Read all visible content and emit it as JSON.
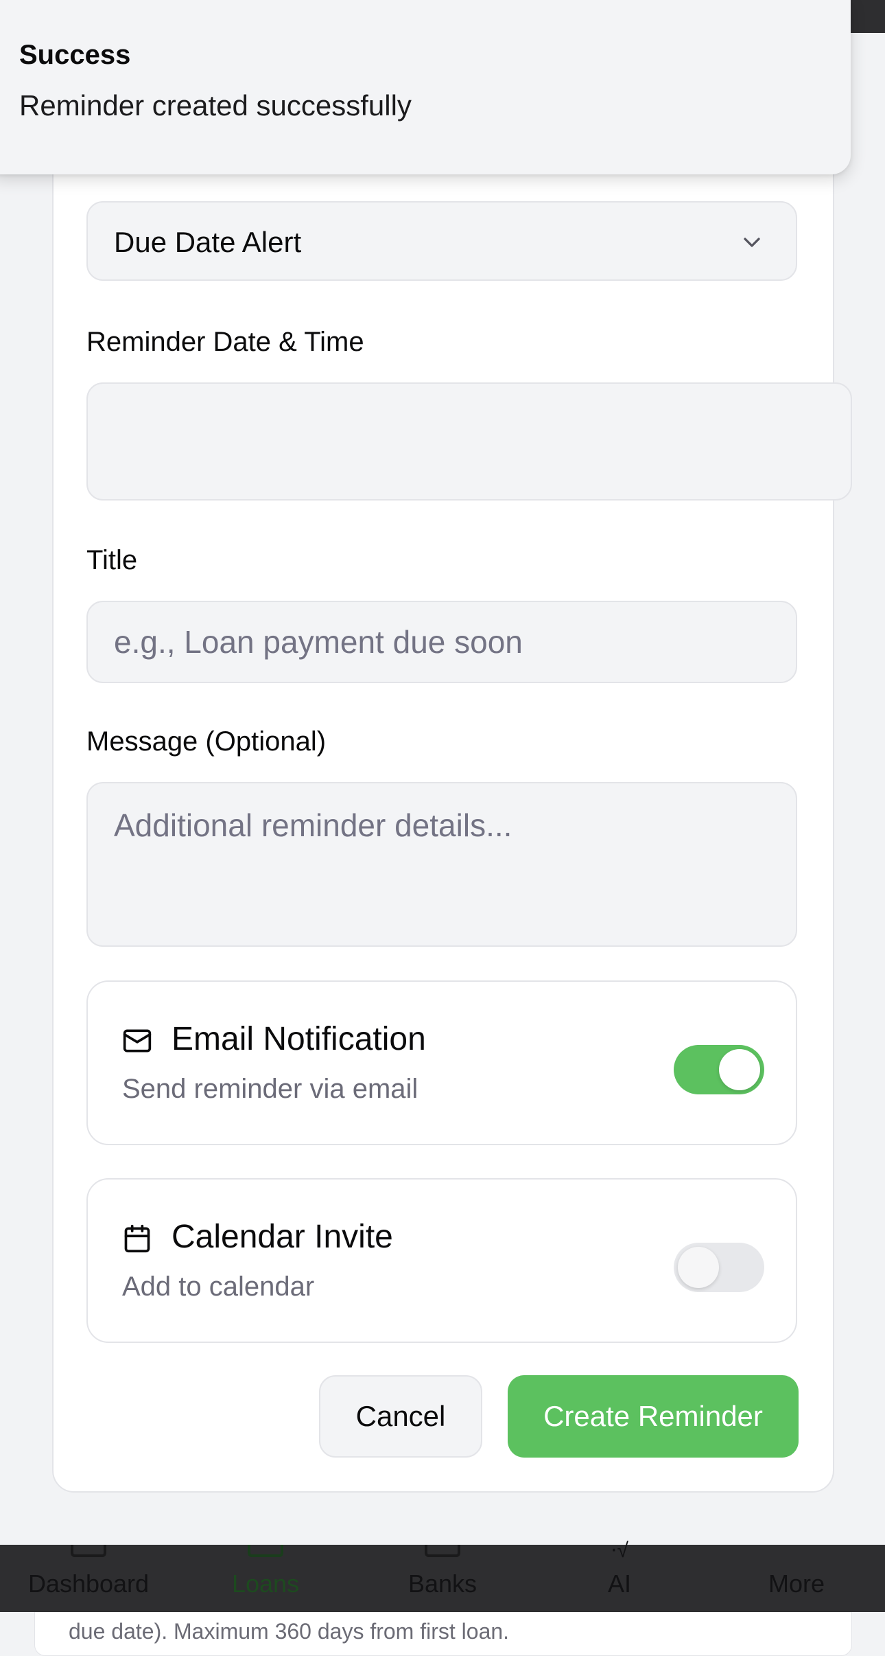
{
  "toast": {
    "title": "Success",
    "message": "Reminder created successfully"
  },
  "form": {
    "reminder_type": {
      "selected": "Due Date Alert"
    },
    "datetime": {
      "label": "Reminder Date & Time",
      "value": ""
    },
    "title": {
      "label": "Title",
      "placeholder": "e.g., Loan payment due soon"
    },
    "message": {
      "label": "Message (Optional)",
      "placeholder": "Additional reminder details..."
    },
    "email_notification": {
      "title": "Email Notification",
      "subtitle": "Send reminder via email",
      "enabled": true
    },
    "calendar_invite": {
      "title": "Calendar Invite",
      "subtitle": "Add to calendar",
      "enabled": false
    },
    "cancel_label": "Cancel",
    "create_label": "Create Reminder"
  },
  "bottom_nav": {
    "items": [
      {
        "label": "Dashboard"
      },
      {
        "label": "Loans",
        "active": true
      },
      {
        "label": "Banks"
      },
      {
        "label": "AI"
      },
      {
        "label": "More"
      }
    ]
  },
  "background": {
    "partial_text": "due date). Maximum 360 days from first loan."
  },
  "colors": {
    "accent_green": "#5cc15f",
    "nav_background": "#2e2e30"
  }
}
